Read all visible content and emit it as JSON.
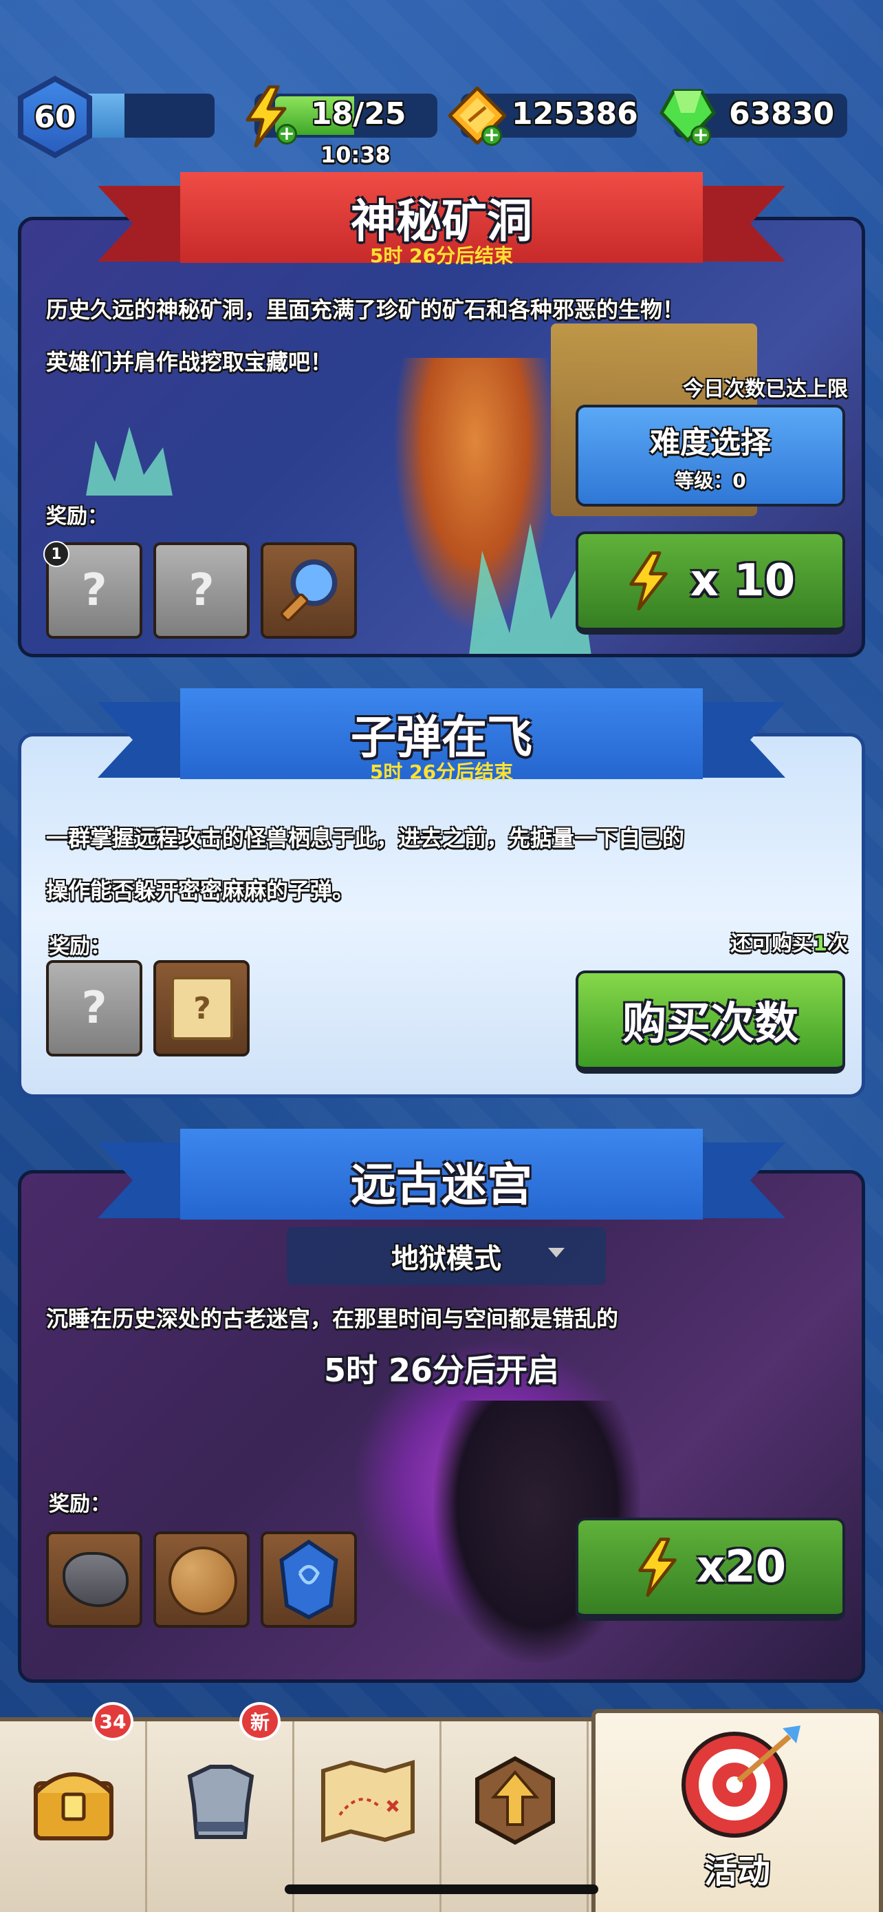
{
  "status": {
    "level": "60",
    "xp_progress": 0.32,
    "energy": "18/25",
    "energy_progress": 0.72,
    "energy_timer": "10:38",
    "gold": "125386",
    "gems": "63830"
  },
  "events": [
    {
      "title": "神秘矿洞",
      "countdown": "5时 26分后结束",
      "description_line1": "历史久远的神秘矿洞，里面充满了珍矿的矿石和各种邪恶的生物！",
      "description_line2": "英雄们并肩作战挖取宝藏吧！",
      "limit_note": "今日次数已达上限",
      "difficulty_button": "难度选择",
      "difficulty_level": "等级：0",
      "reward_label": "奖励：",
      "reward_badge": "1",
      "cost": "x 10",
      "ribbon_color": "#d9342f"
    },
    {
      "title": "子弹在飞",
      "countdown": "5时 26分后结束",
      "description_line1": "一群掌握远程攻击的怪兽栖息于此，进去之前，先掂量一下自己的",
      "description_line2": "操作能否躲开密密麻麻的子弹。",
      "reward_label": "奖励：",
      "buy_note_prefix": "还可购买",
      "buy_note_count": "1",
      "buy_note_suffix": "次",
      "buy_button": "购买次数",
      "ribbon_color": "#2e74dc"
    },
    {
      "title": "远古迷宫",
      "mode": "地狱模式",
      "description": "沉睡在历史深处的古老迷宫，在那里时间与空间都是错乱的",
      "countdown": "5时 26分后开启",
      "reward_label": "奖励：",
      "cost": "x20",
      "ribbon_color": "#2e74dc"
    }
  ],
  "nav": {
    "chest_badge": "34",
    "equip_badge": "新",
    "active_label": "活动"
  }
}
